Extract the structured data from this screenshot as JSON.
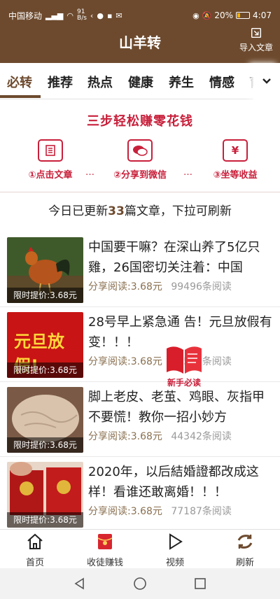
{
  "status_bar": {
    "carrier": "中国移动",
    "signal": "⁴⁶",
    "speed": "91\nB/s",
    "battery_percent": "20%",
    "time": "4:07"
  },
  "header": {
    "title": "山羊转",
    "import_label": "导入文章"
  },
  "tabs": [
    "必转",
    "推荐",
    "热点",
    "健康",
    "养生",
    "情感",
    "育"
  ],
  "active_tab": 0,
  "promo": {
    "title": "三步轻松赚零花钱",
    "steps": [
      {
        "label": "①点击文章",
        "icon": "article-icon"
      },
      {
        "label": "②分享到微信",
        "icon": "wechat-icon"
      },
      {
        "label": "③坐等收益",
        "icon": "yen-icon",
        "glyph": "¥"
      }
    ],
    "dots": "…"
  },
  "update": {
    "prefix": "今日已更新",
    "count": "33",
    "suffix": "篇文章，下拉可刷新"
  },
  "articles": [
    {
      "title": "中国要干嘛？在深山养了5亿只雞，26国密切关注着：中国",
      "price": "限时提价:3.68元",
      "share": "分享阅读:3.68元",
      "reads": "99496条阅读",
      "thumb": "rooster-image"
    },
    {
      "title": "28号早上紧急通 告！元旦放假有变！！！",
      "price": "限时提价:3.68元",
      "share": "分享阅读:3.68元",
      "reads": "76589条阅读",
      "thumb": "holiday-sign-image",
      "thumb_text": "元旦放假!"
    },
    {
      "title": "脚上老皮、老茧、鸡眼、灰指甲不要慌！教你一招小妙方",
      "price": "限时提价:3.68元",
      "share": "分享阅读:3.68元",
      "reads": "44342条阅读",
      "thumb": "foot-skin-image"
    },
    {
      "title": "2020年，以后結婚證都改成这样！看谁还敢离婚！！！",
      "price": "限时提价:3.68元",
      "share": "分享阅读:3.68元",
      "reads": "77187条阅读",
      "thumb": "marriage-certificate-image"
    }
  ],
  "newbie_badge": "新手必读",
  "bottom_nav": [
    {
      "label": "首页",
      "icon": "home-icon"
    },
    {
      "label": "收徒赚钱",
      "icon": "red-envelope-icon"
    },
    {
      "label": "视频",
      "icon": "play-icon"
    },
    {
      "label": "刷新",
      "icon": "refresh-icon"
    }
  ],
  "colors": {
    "brand": "#6d4a2e",
    "accent": "#c8203b"
  }
}
